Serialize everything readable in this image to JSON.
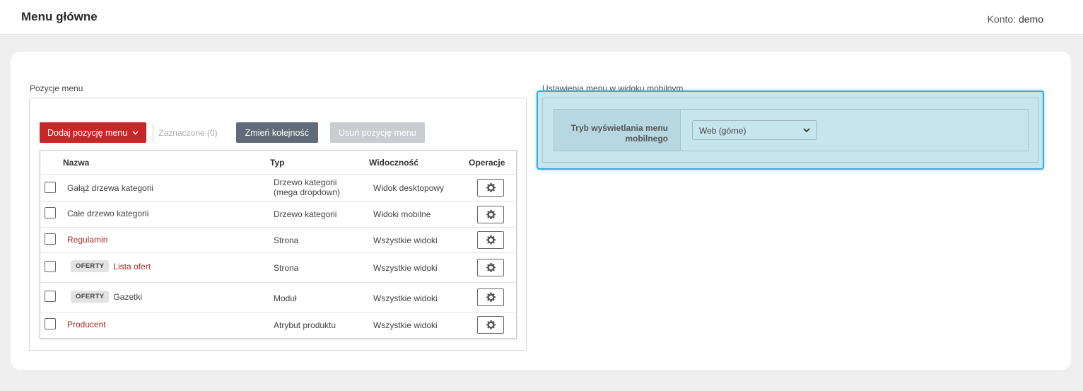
{
  "header": {
    "title": "Menu główne",
    "account_label": "Konto:",
    "account_name": "demo"
  },
  "left": {
    "section_label": "Pozycje menu",
    "toolbar": {
      "add_label": "Dodaj pozycję menu",
      "selected_label": "Zaznaczone (0)",
      "reorder_label": "Zmień kolejność",
      "delete_label": "Usuń pozycję menu"
    },
    "columns": {
      "name": "Nazwa",
      "type": "Typ",
      "visibility": "Widoczność",
      "ops": "Operacje"
    },
    "rows": [
      {
        "name": "Gałąź drzewa kategorii",
        "type_line1": "Drzewo kategorii",
        "type_line2": "(mega dropdown)",
        "visibility": "Widok desktopowy",
        "badge": "",
        "link": false
      },
      {
        "name": "Całe drzewo kategorii",
        "type_line1": "Drzewo kategorii",
        "type_line2": "",
        "visibility": "Widoki mobilne",
        "badge": "",
        "link": false
      },
      {
        "name": "Regulamin",
        "type_line1": "Strona",
        "type_line2": "",
        "visibility": "Wszystkie widoki",
        "badge": "",
        "link": true
      },
      {
        "name": "Lista ofert",
        "type_line1": "Strona",
        "type_line2": "",
        "visibility": "Wszystkie widoki",
        "badge": "OFERTY",
        "link": true
      },
      {
        "name": "Gazetki",
        "type_line1": "Moduł",
        "type_line2": "",
        "visibility": "Wszystkie widoki",
        "badge": "OFERTY",
        "link": false
      },
      {
        "name": "Producent",
        "type_line1": "Atrybut produktu",
        "type_line2": "",
        "visibility": "Wszystkie widoki",
        "badge": "",
        "link": true
      }
    ]
  },
  "right": {
    "section_label": "Ustawienia menu w widoku mobilnym",
    "setting_label": "Tryb wyświetlania menu mobilnego",
    "select_value": "Web (górne)"
  },
  "colors": {
    "accent_red": "#c62828",
    "link_red": "#a52a2a",
    "highlight_blue": "#2eaee0",
    "highlight_fill": "#c6e5ec"
  }
}
